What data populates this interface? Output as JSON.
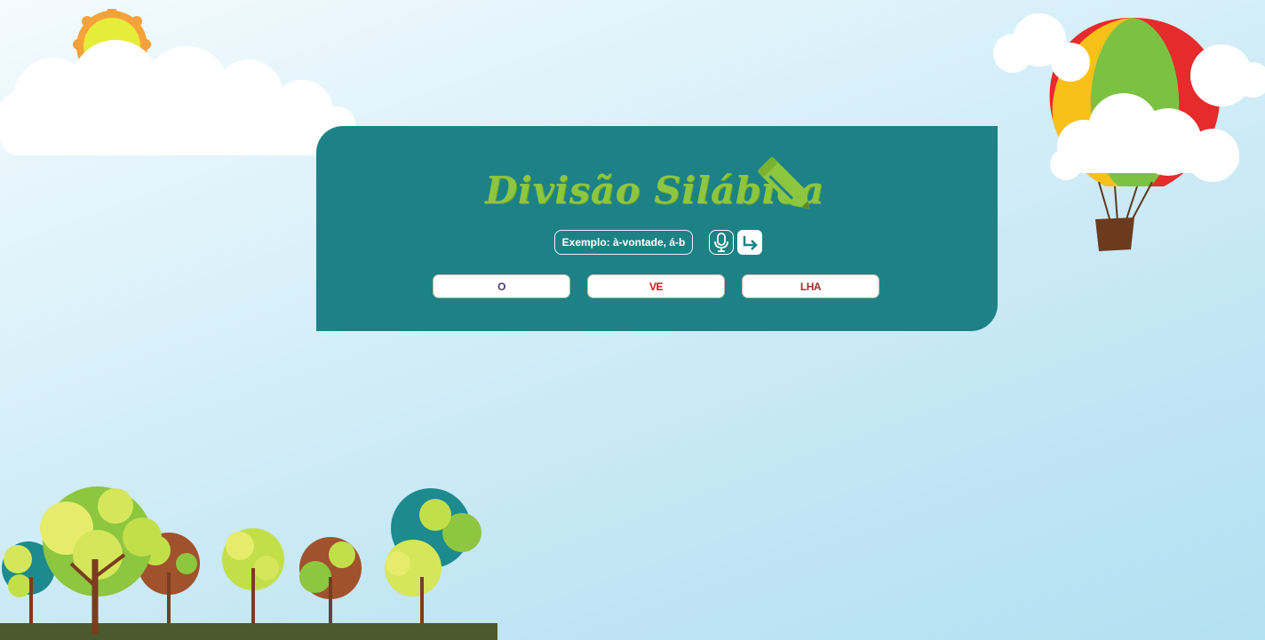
{
  "app": {
    "title": "Divisão Silábica"
  },
  "search": {
    "placeholder": "Exemplo: à-vontade, á-b",
    "value": ""
  },
  "icons": {
    "mic": "microphone-icon",
    "submit": "enter-arrow-icon",
    "title_decoration": "pencil-icon"
  },
  "syllables": [
    {
      "label": "O"
    },
    {
      "label": "VE"
    },
    {
      "label": "LHA"
    }
  ],
  "colors": {
    "panel": "#1c8286",
    "title": "#8dc63f",
    "syllable_1": "#4a3a6e",
    "syllable_2": "#d0161b",
    "syllable_3": "#a32d2d"
  }
}
